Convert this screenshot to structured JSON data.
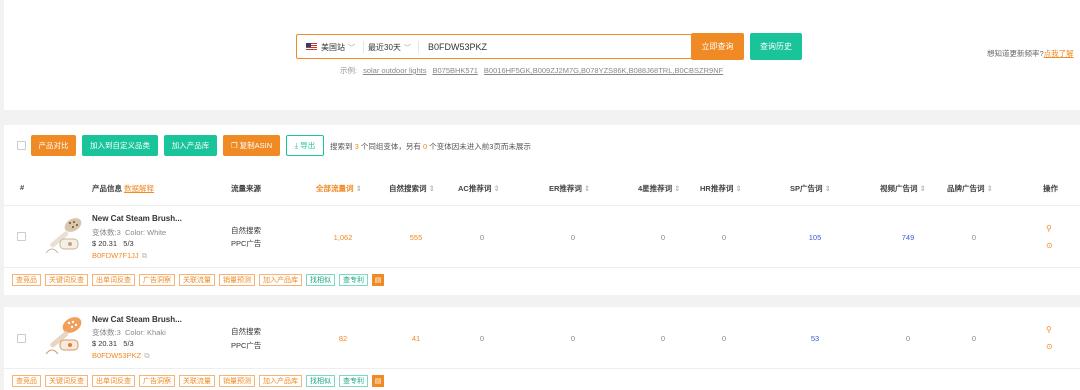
{
  "search": {
    "marketplace": "美国站",
    "period": "最近30天",
    "query": "B0FDW53PKZ",
    "query_button": "立即查询",
    "history_button": "查询历史",
    "examples_label": "示例:",
    "examples": [
      "solar outdoor lights",
      "B075BHK571",
      "B0016HF5GK,B009ZJ2M7G,B078YZS86K,B088J68TRL,B0CBSZR9NF"
    ],
    "freq_hint": "想知道更新频率?",
    "freq_link": "点我了解"
  },
  "toolbar": {
    "compare": "产品对比",
    "add_custom_category": "加入到自定义品类",
    "add_library": "加入产品库",
    "copy_asin": "复制ASIN",
    "export": "导出",
    "summary_prefix": "搜索到",
    "summary_count": "3",
    "summary_mid": "个同组变体，另有",
    "summary_hidden": "0",
    "summary_suffix": "个变体因未进入前3页而未展示"
  },
  "columns": {
    "index": "#",
    "product_info": "产品信息",
    "data_explain": "数据解释",
    "traffic_source": "流量来源",
    "all_keywords": "全部流量词",
    "organic": "自然搜索词",
    "ac": "AC推荐词",
    "er": "ER推荐词",
    "four_star": "4星推荐词",
    "hr": "HR推荐词",
    "sp": "SP广告词",
    "video": "视频广告词",
    "brand": "品牌广告词",
    "action": "操作"
  },
  "rows": [
    {
      "title": "New Cat Steam Brush...",
      "variants": "变体数:3",
      "color": "Color: White",
      "price": "$ 20.31",
      "rating": "5/3",
      "asin": "B0FDW7F1JJ",
      "source_1": "自然搜索",
      "source_2": "PPC广告",
      "all": "1,062",
      "organic": "555",
      "ac": "0",
      "er": "0",
      "four_star": "0",
      "hr": "0",
      "sp": "105",
      "video": "749",
      "brand": "0"
    },
    {
      "title": "New Cat Steam Brush...",
      "variants": "变体数:3",
      "color": "Color: Khaki",
      "price": "$ 20.31",
      "rating": "5/3",
      "asin": "B0FDW53PKZ",
      "source_1": "自然搜索",
      "source_2": "PPC广告",
      "all": "82",
      "organic": "41",
      "ac": "0",
      "er": "0",
      "four_star": "0",
      "hr": "0",
      "sp": "53",
      "video": "0",
      "brand": "0"
    }
  ],
  "tags": [
    "查竞品",
    "关键词反查",
    "出单词反查",
    "广告洞察",
    "关联流量",
    "销量预测",
    "加入产品库",
    "找相似",
    "查专利"
  ],
  "colors": {
    "accent": "#f08a24",
    "green": "#19c49a",
    "blue": "#3b5bdb"
  }
}
